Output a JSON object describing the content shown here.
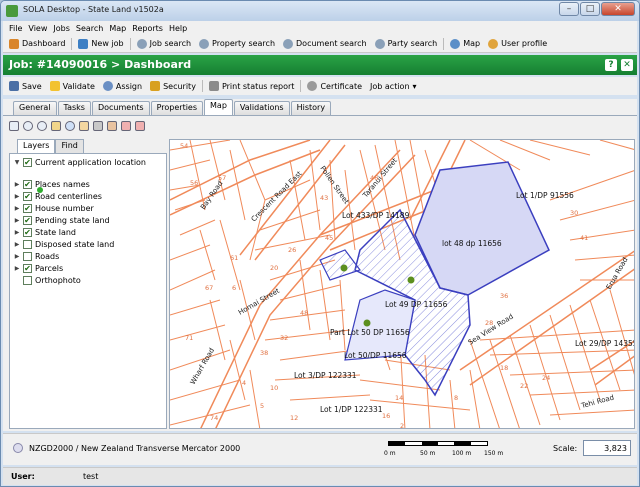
{
  "window": {
    "title": "SOLA Desktop - State Land v1502a"
  },
  "menu": [
    "File",
    "View",
    "Jobs",
    "Search",
    "Map",
    "Reports",
    "Help"
  ],
  "toolbar": [
    "Dashboard",
    "New job",
    "Job search",
    "Property search",
    "Document search",
    "Party search",
    "Map",
    "User profile"
  ],
  "job": {
    "title": "Job: #14090016 > Dashboard",
    "help": "?",
    "close": "✕"
  },
  "actions": [
    "Save",
    "Validate",
    "Assign",
    "Security",
    "Print status report",
    "Certificate",
    "Job action"
  ],
  "tabs": [
    "General",
    "Tasks",
    "Documents",
    "Properties",
    "Map",
    "Validations",
    "History"
  ],
  "active_tab": "Map",
  "layer_tabs": [
    "Layers",
    "Find"
  ],
  "layers": [
    {
      "label": "Current application location",
      "checked": true,
      "expandable": true
    },
    {
      "label": "Places names",
      "checked": true,
      "expandable": true
    },
    {
      "label": "Road centerlines",
      "checked": true,
      "expandable": true
    },
    {
      "label": "House number",
      "checked": true,
      "expandable": true
    },
    {
      "label": "Pending state land",
      "checked": true,
      "expandable": true
    },
    {
      "label": "State land",
      "checked": true,
      "expandable": true
    },
    {
      "label": "Disposed state land",
      "checked": false,
      "expandable": true
    },
    {
      "label": "Roads",
      "checked": false,
      "expandable": true
    },
    {
      "label": "Parcels",
      "checked": true,
      "expandable": true
    },
    {
      "label": "Orthophoto",
      "checked": false,
      "expandable": false
    }
  ],
  "map": {
    "streets": [
      "Bay Road",
      "Crescent Road East",
      "Pollen Street",
      "Taranui Street",
      "Homai Street",
      "Wharf Road",
      "Sea View Road",
      "Erua Road",
      "Tehi Road"
    ],
    "parcels": [
      "Lot 1/DP 91556",
      "Lot 433/DP 14189",
      "lot 48  dp 11656",
      "Lot 49  DP 11656",
      "Part Lot 50 DP 11656",
      "Lot 50/DP 11656",
      "Lot 3/DP 122331",
      "Lot 1/DP 122331",
      "Lot 29/DP 14355"
    ],
    "house_numbers": [
      "2",
      "4",
      "5",
      "6",
      "8",
      "10",
      "12",
      "14",
      "16",
      "18",
      "20",
      "22",
      "24",
      "26",
      "28",
      "30",
      "32",
      "36",
      "38",
      "41",
      "43",
      "45",
      "46",
      "48",
      "54",
      "56",
      "57",
      "61",
      "67",
      "71",
      "74"
    ]
  },
  "status": {
    "crs": "NZGD2000 / New Zealand Transverse Mercator 2000",
    "scale_ticks": [
      "0 m",
      "50 m",
      "100 m",
      "150 m"
    ],
    "scale_label": "Scale:",
    "scale_value": "3,823"
  },
  "user": {
    "label": "User:",
    "name": "test"
  }
}
